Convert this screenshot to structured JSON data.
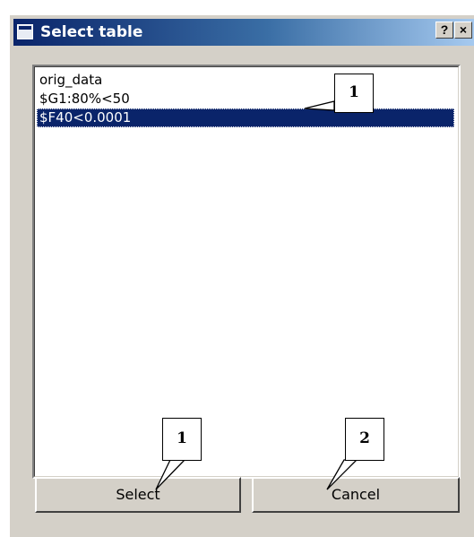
{
  "window": {
    "title": "Select table",
    "help_label": "?",
    "close_label": "×"
  },
  "tables": [
    {
      "label": "orig_data",
      "selected": false
    },
    {
      "label": "$G1:80%<50",
      "selected": false
    },
    {
      "label": "$F40<0.0001",
      "selected": true
    }
  ],
  "buttons": {
    "select_label": "Select",
    "cancel_label": "Cancel"
  },
  "annotations": {
    "list_callout": "1",
    "select_callout": "1",
    "cancel_callout": "2"
  }
}
